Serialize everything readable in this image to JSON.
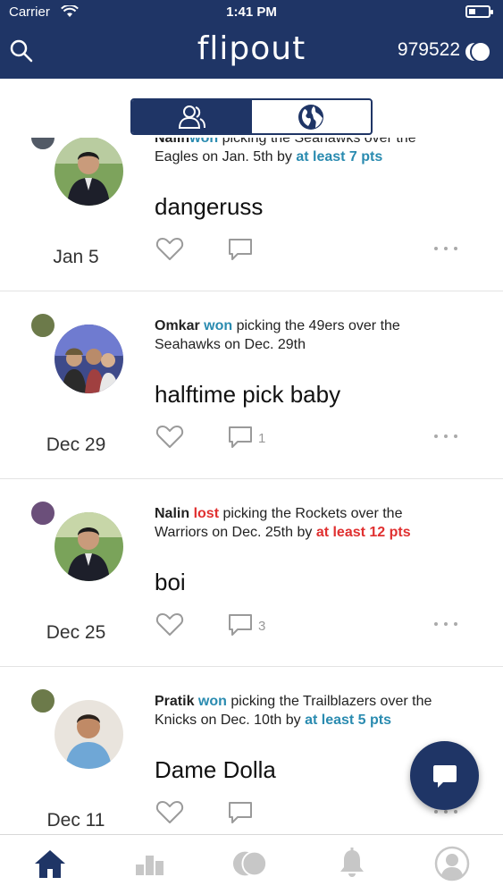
{
  "status_bar": {
    "carrier": "Carrier",
    "time": "1:41 PM"
  },
  "header": {
    "brand": "flipout",
    "score": "979522"
  },
  "colors": {
    "primary": "#1f3566",
    "won": "#2a8bb0",
    "lost": "#e03030",
    "inactive_icon": "#c7c7c7"
  },
  "segment": {
    "options": [
      "friends-icon",
      "globe-icon"
    ],
    "active_index": 0
  },
  "posts": [
    {
      "user": "Nalin",
      "result": "won",
      "text": " picking the Seahawks over the",
      "text2": "Eagles on Jan. 5th by ",
      "margin": "at least 7 pts",
      "caption": "dangeruss",
      "date": "Jan 5",
      "comments": ""
    },
    {
      "user": "Omkar",
      "result": "won",
      "text": " picking the 49ers over the",
      "text2": "Seahawks on Dec. 29th",
      "margin": "",
      "caption": "halftime pick baby",
      "date": "Dec 29",
      "comments": "1"
    },
    {
      "user": "Nalin",
      "result": "lost",
      "text": " picking the Rockets over the",
      "text2": "Warriors on Dec. 25th by ",
      "margin": "at least 12 pts",
      "caption": "boi",
      "date": "Dec 25",
      "comments": "3"
    },
    {
      "user": "Pratik",
      "result": "won",
      "text": " picking the Trailblazers over the",
      "text2": "Knicks on Dec. 10th by ",
      "margin": "at least 5 pts",
      "caption": "Dame Dolla",
      "date": "Dec 11",
      "comments": ""
    }
  ],
  "tab_bar": {
    "items": [
      "home-icon",
      "leaderboard-icon",
      "coins-icon",
      "bell-icon",
      "profile-icon"
    ],
    "active_index": 0
  }
}
